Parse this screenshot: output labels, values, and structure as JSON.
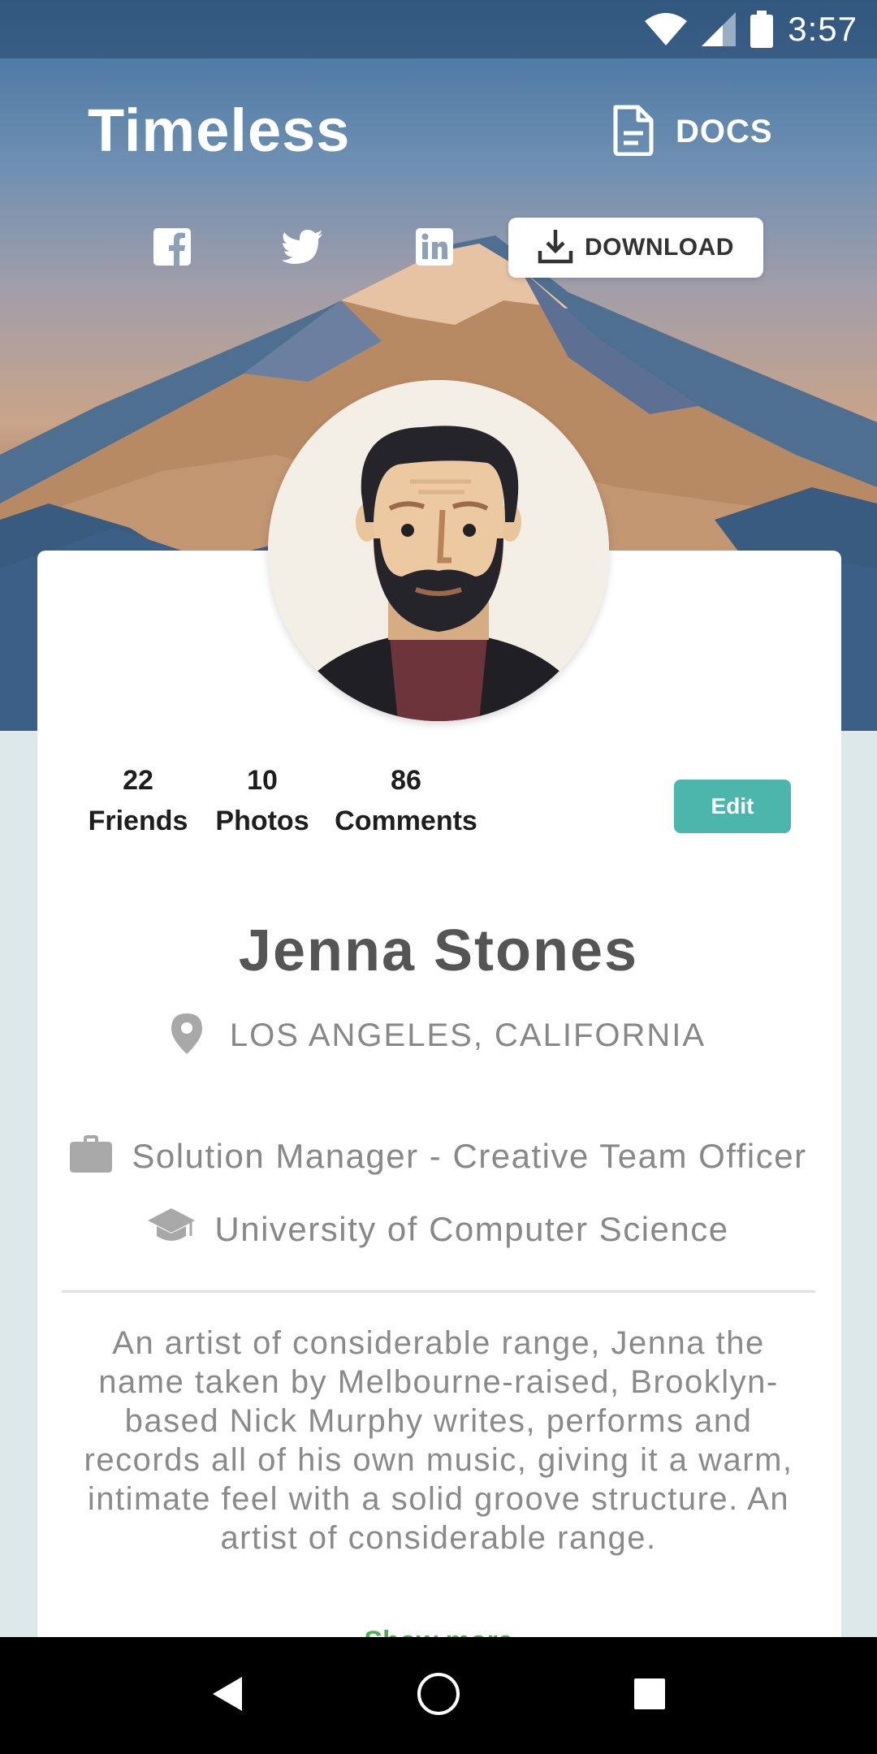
{
  "status_bar": {
    "time": "3:57",
    "icons": [
      "wifi-icon",
      "signal-icon",
      "battery-icon"
    ]
  },
  "header": {
    "brand": "Timeless",
    "docs_label": "DOCS",
    "docs_icon": "document-icon",
    "social_icons": [
      "facebook-icon",
      "twitter-icon",
      "linkedin-icon"
    ],
    "download_label": "DOWNLOAD",
    "download_icon": "download-icon"
  },
  "profile": {
    "stats": [
      {
        "value": "22",
        "label": "Friends"
      },
      {
        "value": "10",
        "label": "Photos"
      },
      {
        "value": "86",
        "label": "Comments"
      }
    ],
    "edit_label": "Edit",
    "name": "Jenna Stones",
    "location": "LOS ANGELES, CALIFORNIA",
    "job": "Solution Manager - Creative Team Officer",
    "education": "University of Computer Science",
    "bio": "An artist of considerable range, Jenna the name taken by Melbourne-raised, Brooklyn-based Nick Murphy writes, performs and records all of his own music, giving it a warm, intimate feel with a solid groove structure. An artist of considerable range.",
    "show_more_label": "Show more"
  },
  "colors": {
    "accent": "#4db6ac",
    "link": "#4caf50",
    "text_muted": "#888888",
    "text_dark": "#1e1e1e"
  },
  "nav_bar": {
    "icons": [
      "back-icon",
      "home-icon",
      "recents-icon"
    ]
  }
}
